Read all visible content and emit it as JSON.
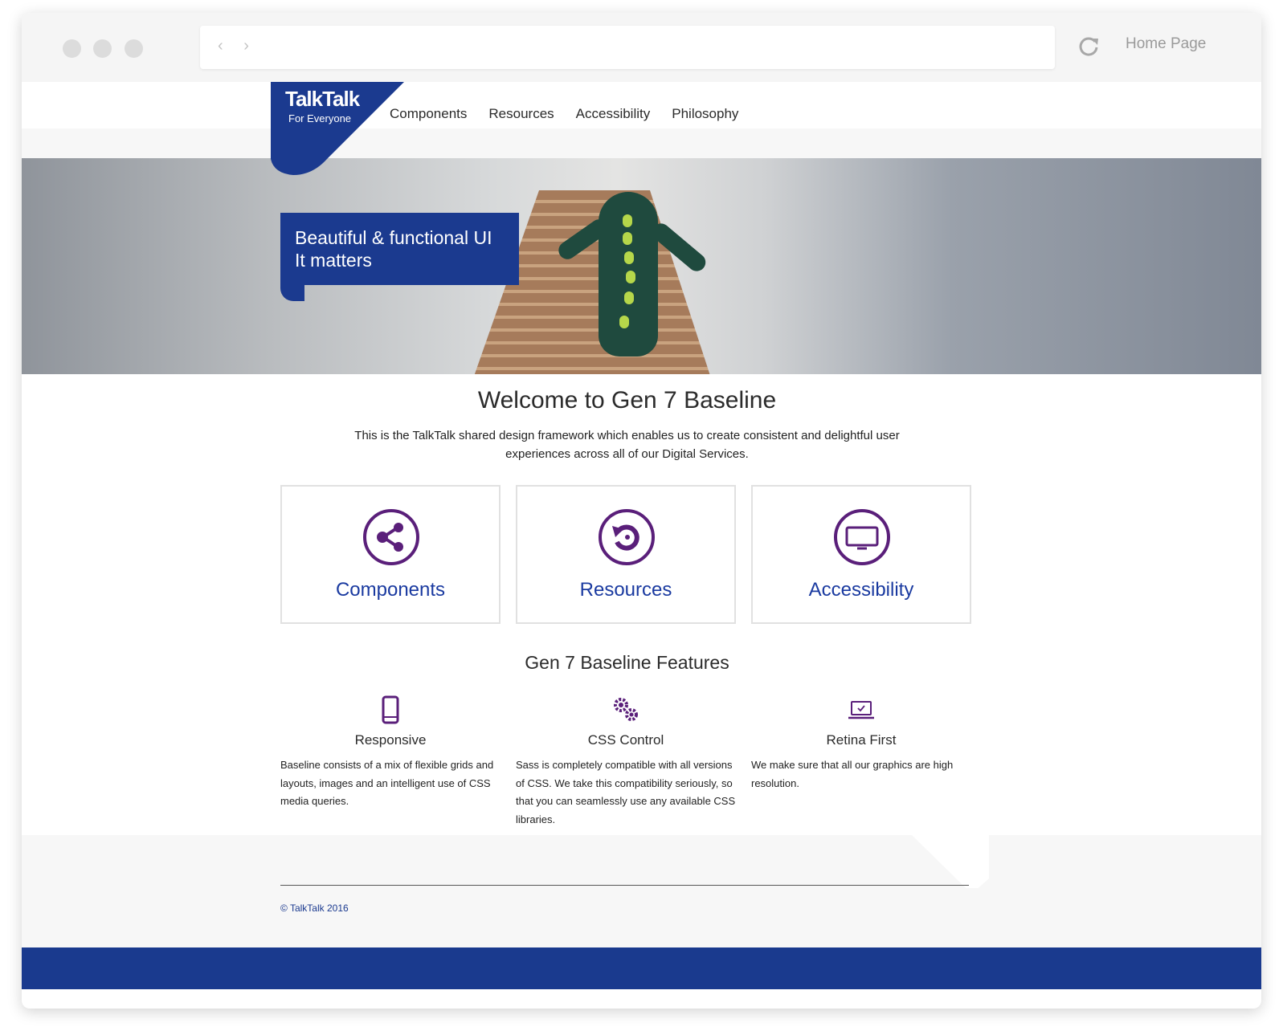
{
  "browser": {
    "page_title": "Home Page",
    "nav_arrows": "‹ ›"
  },
  "logo": {
    "brand": "TalkTalk",
    "tagline": "For Everyone"
  },
  "nav": {
    "items": [
      "Components",
      "Resources",
      "Accessibility",
      "Philosophy"
    ]
  },
  "hero": {
    "line1": "Beautiful & functional UI",
    "line2": "It matters"
  },
  "welcome": {
    "title": "Welcome to Gen 7 Baseline",
    "intro": "This is the TalkTalk shared design framework which enables us to create consistent and delightful user experiences across all of our Digital Services."
  },
  "cards": [
    {
      "label": "Components",
      "icon": "share-icon"
    },
    {
      "label": "Resources",
      "icon": "refresh-icon"
    },
    {
      "label": "Accessibility",
      "icon": "monitor-icon"
    }
  ],
  "features": {
    "title": "Gen 7 Baseline Features",
    "items": [
      {
        "title": "Responsive",
        "icon": "mobile-icon",
        "text": "Baseline consists of a mix of flexible grids and layouts, images and an intelligent use of CSS media queries."
      },
      {
        "title": "CSS Control",
        "icon": "gears-icon",
        "text": "Sass is completely compatible with all versions of CSS. We take this compatibility seriously, so that you can seamlessly use any available CSS libraries."
      },
      {
        "title": "Retina First",
        "icon": "laptop-check-icon",
        "text": "We make sure that all our graphics are high resolution."
      }
    ]
  },
  "footer": {
    "copyright": "© TalkTalk 2016"
  },
  "colors": {
    "brand_blue": "#1b3a8f",
    "accent_purple": "#5a1f7a",
    "link_blue": "#1a3aa0"
  }
}
